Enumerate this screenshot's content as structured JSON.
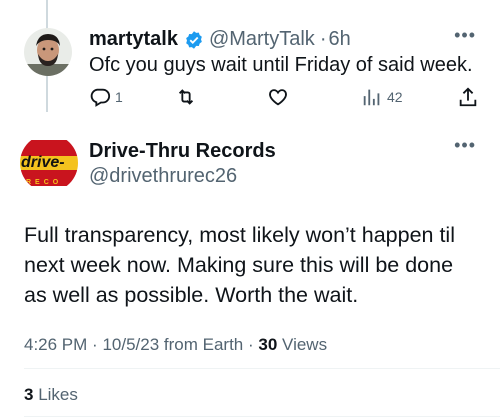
{
  "reply": {
    "display_name": "martytalk",
    "handle": "@MartyTalk",
    "separator": "·",
    "time": "6h",
    "text": "Ofc you guys wait until Friday of said week.",
    "verified": true,
    "more_icon": "more-horizontal-icon",
    "actions": {
      "reply_count": "1",
      "retweet_count": "",
      "like_count": "",
      "views_count": "42"
    }
  },
  "original": {
    "display_name": "Drive-Thru Records",
    "handle": "@drivethrurec26",
    "avatar": {
      "logo_word": "drive-",
      "logo_sub": "RECO",
      "colors": {
        "bg": "#c9141e",
        "band": "#f4c21e",
        "text": "#111111"
      }
    },
    "text_lines": [
      "Full transparency, most likely won’t happen til",
      "next week now. Making sure this will be done",
      "as well as possible. Worth the wait."
    ],
    "time": "4:26 PM",
    "date": "10/5/23",
    "source": "from Earth",
    "views_count": "30",
    "views_label": "Views",
    "likes_count": "3",
    "likes_label": "Likes"
  },
  "colors": {
    "text": "#0f1419",
    "muted": "#536471",
    "verified": "#1d9bf0",
    "line": "#cfd9de"
  }
}
